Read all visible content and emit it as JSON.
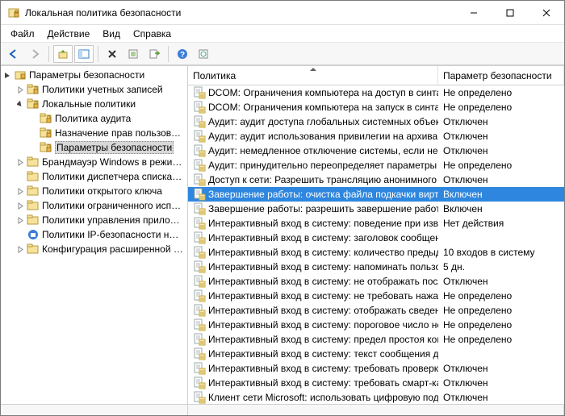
{
  "window": {
    "title": "Локальная политика безопасности"
  },
  "menu": {
    "file": "Файл",
    "action": "Действие",
    "view": "Вид",
    "help": "Справка"
  },
  "tree": {
    "root": "Параметры безопасности",
    "nodes": [
      {
        "label": "Политики учетных записей",
        "indent": 1,
        "exp": "collapsed",
        "icon": "folder-lock"
      },
      {
        "label": "Локальные политики",
        "indent": 1,
        "exp": "expanded",
        "icon": "folder-lock"
      },
      {
        "label": "Политика аудита",
        "indent": 2,
        "exp": "none",
        "icon": "folder-lock"
      },
      {
        "label": "Назначение прав пользователя",
        "indent": 2,
        "exp": "none",
        "icon": "folder-lock"
      },
      {
        "label": "Параметры безопасности",
        "indent": 2,
        "exp": "none",
        "icon": "folder-lock",
        "selected": true
      },
      {
        "label": "Брандмауэр Windows в режиме повы",
        "indent": 1,
        "exp": "collapsed",
        "icon": "folder"
      },
      {
        "label": "Политики диспетчера списка сетей",
        "indent": 1,
        "exp": "none",
        "icon": "folder"
      },
      {
        "label": "Политики открытого ключа",
        "indent": 1,
        "exp": "collapsed",
        "icon": "folder"
      },
      {
        "label": "Политики ограниченного использов",
        "indent": 1,
        "exp": "collapsed",
        "icon": "folder"
      },
      {
        "label": "Политики управления приложения",
        "indent": 1,
        "exp": "collapsed",
        "icon": "folder"
      },
      {
        "label": "Политики IP-безопасности на \"Лок",
        "indent": 1,
        "exp": "none",
        "icon": "ipsec"
      },
      {
        "label": "Конфигурация расширенной полит",
        "indent": 1,
        "exp": "collapsed",
        "icon": "folder"
      }
    ]
  },
  "list": {
    "col1": "Политика",
    "col2": "Параметр безопасности",
    "rows": [
      {
        "policy": "DCOM: Ограничения компьютера на доступ в синтаксис…",
        "value": "Не определено"
      },
      {
        "policy": "DCOM: Ограничения компьютера на запуск в синтаксис…",
        "value": "Не определено"
      },
      {
        "policy": "Аудит: аудит доступа глобальных системных объектов",
        "value": "Отключен"
      },
      {
        "policy": "Аудит: аудит использования привилегии на архивацию и…",
        "value": "Отключен"
      },
      {
        "policy": "Аудит: немедленное отключение системы, если невозм…",
        "value": "Отключен"
      },
      {
        "policy": "Аудит: принудительно переопределяет параметры катег…",
        "value": "Не определено"
      },
      {
        "policy": "Доступ к сети: Разрешить трансляцию анонимного SID в …",
        "value": "Отключен"
      },
      {
        "policy": "Завершение работы: очистка файла подкачки виртуальн…",
        "value": "Включен",
        "selected": true
      },
      {
        "policy": "Завершение работы: разрешить завершение работы сис…",
        "value": "Включен"
      },
      {
        "policy": "Интерактивный вход в систему:  поведение при извлечен…",
        "value": "Нет действия"
      },
      {
        "policy": "Интерактивный вход в систему: заголовок сообщения дл…",
        "value": ""
      },
      {
        "policy": "Интерактивный вход в систему: количество предыдущих …",
        "value": "10 входов в систему"
      },
      {
        "policy": "Интерактивный вход в систему: напоминать пользовател…",
        "value": "5 дн."
      },
      {
        "policy": "Интерактивный вход в систему: не отображать последне…",
        "value": "Отключен"
      },
      {
        "policy": "Интерактивный вход в систему: не требовать нажатия CT…",
        "value": "Не определено"
      },
      {
        "policy": "Интерактивный вход в систему: отображать сведения о п…",
        "value": "Не определено"
      },
      {
        "policy": "Интерактивный вход в систему: пороговое число неудач…",
        "value": "Не определено"
      },
      {
        "policy": "Интерактивный вход в систему: предел простоя компьют…",
        "value": "Не определено"
      },
      {
        "policy": "Интерактивный вход в систему: текст сообщения для по…",
        "value": ""
      },
      {
        "policy": "Интерактивный вход в систему: требовать проверки на к…",
        "value": "Отключен"
      },
      {
        "policy": "Интерактивный вход в систему: требовать смарт-карту",
        "value": "Отключен"
      },
      {
        "policy": "Клиент сети Microsoft: использовать цифровую подпись …",
        "value": "Отключен"
      }
    ]
  }
}
